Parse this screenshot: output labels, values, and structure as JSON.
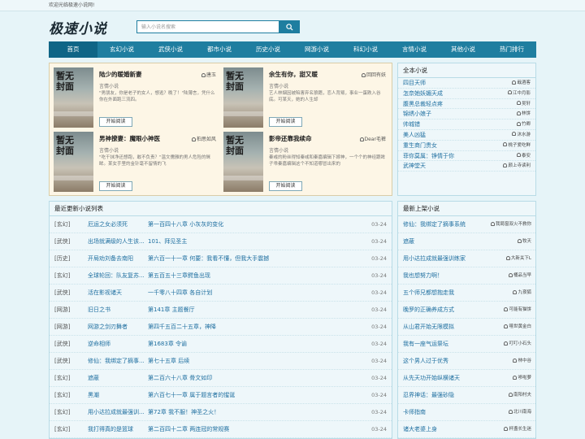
{
  "topbar": {
    "welcome": "欢迎光临极速小说网!"
  },
  "header": {
    "logo": "极速小说"
  },
  "search": {
    "placeholder": "输入小说名搜索"
  },
  "nav": [
    "首页",
    "玄幻小说",
    "武侠小说",
    "都市小说",
    "历史小说",
    "网游小说",
    "科幻小说",
    "言情小说",
    "其他小说",
    "热门排行"
  ],
  "featured": {
    "cover_text": "暂无封面",
    "read_label": "开始阅读",
    "items": [
      {
        "title": "陆少的暖婚新妻",
        "author": "唐玉",
        "category": "言情小说",
        "desc": "\"男朋友，你是老子的女人，想逃？晚了！\"陆薄言，凭什么你在外面跑三流四。"
      },
      {
        "title": "余生有你，甜又暖",
        "author": "回回有妖",
        "category": "言情小说",
        "desc": "艺人林烟因被陷害弃名狼籍，恋人背叛，事业一蛋跌入谷底。可某天，她的人生却"
      },
      {
        "title": "男神撩妻：魔眼小神医",
        "author": "桕思如风",
        "category": "言情小说",
        "desc": "\"吃干抹净还想跑，敢不负责？\"温文儒雅的男人危险的眯眸。某女手里的金针毫不留情的飞"
      },
      {
        "title": "影帝还靠我续命",
        "author": "Dear毛裤",
        "category": "言情小说",
        "desc": "秦彧的粉丝得知秦彧和秦嘉编辑下嫁神，一个个的神经跟眸子乖秦嘉编辑这个不知道哪冒出来的"
      }
    ]
  },
  "fulllist": {
    "title": "全本小说",
    "items": [
      {
        "title": "四目天师",
        "author": "戢酒客"
      },
      {
        "title": "怎奈她妖媚天成",
        "author": "江中月影"
      },
      {
        "title": "腹黑总裁轻点疼",
        "author": "吴轩"
      },
      {
        "title": "锦绣小娘子",
        "author": "林饼"
      },
      {
        "title": "帅城错",
        "author": "竹卿"
      },
      {
        "title": "美人凶猛",
        "author": "沐水游"
      },
      {
        "title": "重生商门贵女",
        "author": "桃子爱吃鲜"
      },
      {
        "title": "菲你莫属：铮情于你",
        "author": "泰安"
      },
      {
        "title": "武神堂天",
        "author": "颜上寺读利"
      }
    ]
  },
  "updates": {
    "title": "最近更新小说列表",
    "rows": [
      {
        "cat": "[玄幻]",
        "name": "厄运之女必须死",
        "chapter": "第一百四十八章 小灰灰的变化",
        "date": "03-24"
      },
      {
        "cat": "[武侠]",
        "name": "出场就满级的人生该...",
        "chapter": "101、拜见圣主",
        "date": "03-24"
      },
      {
        "cat": "[历史]",
        "name": "开局劝刘备去南阳",
        "chapter": "第六百一十一章 何要：我看不懂，但我大手震撼",
        "date": "03-24"
      },
      {
        "cat": "[玄幻]",
        "name": "全球轮回：队友复苏...",
        "chapter": "第五百五十三章鳄鱼出现",
        "date": "03-24"
      },
      {
        "cat": "[武侠]",
        "name": "活在影视诸天",
        "chapter": "一千零八十四章 各自计划",
        "date": "03-24"
      },
      {
        "cat": "[网游]",
        "name": "旧日之书",
        "chapter": "第141章 主题餐厅",
        "date": "03-24"
      },
      {
        "cat": "[网游]",
        "name": "网游之剑刃舞者",
        "chapter": "第四千五百二十五章，神降",
        "date": "03-24"
      },
      {
        "cat": "[武侠]",
        "name": "逆命相师",
        "chapter": "第1683章 令谕",
        "date": "03-24"
      },
      {
        "cat": "[武侠]",
        "name": "修仙：我绑定了摘事...",
        "chapter": "第七十五章 后续",
        "date": "03-24"
      },
      {
        "cat": "[玄幻]",
        "name": "遮蔽",
        "chapter": "第二百六十八章 骨文如印",
        "date": "03-24"
      },
      {
        "cat": "[玄幻]",
        "name": "黑潮",
        "chapter": "第六百七十一章 属于题言者的惺诞",
        "date": "03-24"
      },
      {
        "cat": "[玄幻]",
        "name": "用小达拉成就最强训...",
        "chapter": "第72章 我不服！神圣之火！",
        "date": "03-24"
      },
      {
        "cat": "[玄幻]",
        "name": "我打得真的是篮球",
        "chapter": "第二百四十二章 两连冠的常规赛",
        "date": "03-24"
      }
    ]
  },
  "newbooks": {
    "title": "最新上架小说",
    "items": [
      {
        "title": "修仙：我绑定了摘事系统",
        "author": "我局窗双火不救你"
      },
      {
        "title": "遮蔽",
        "author": "牧天"
      },
      {
        "title": "用小达拉成就最强训练家",
        "author": "大新关下L"
      },
      {
        "title": "我也想努力啊！",
        "author": "桶品当早"
      },
      {
        "title": "五个师兄都想抱走我",
        "author": "九夜狐"
      },
      {
        "title": "晚罗的正确养成方式",
        "author": "可能有猫饼"
      },
      {
        "title": "从山君开始无限模拟",
        "author": "嘻世黄金白"
      },
      {
        "title": "我有一座气运祭坛",
        "author": "叮叮小石头"
      },
      {
        "title": "这个男人过于优秀",
        "author": "林中谷"
      },
      {
        "title": "从先天功开始纵横诸天",
        "author": "哆啦萝"
      },
      {
        "title": "忍界神话：最强砂隐",
        "author": "南阳村夫"
      },
      {
        "title": "卡师指南",
        "author": "北川南海"
      },
      {
        "title": "诸大老婆上身",
        "author": "杯盏长生迷"
      }
    ]
  },
  "colors": {
    "accent": "#1f7ea0",
    "nav_active": "#0f6586",
    "link": "#1f6fa0",
    "background": "#e6f4f8",
    "featured_bg": "#fdf6e6"
  },
  "icons": {
    "search": "search-icon",
    "author": "user-icon"
  }
}
